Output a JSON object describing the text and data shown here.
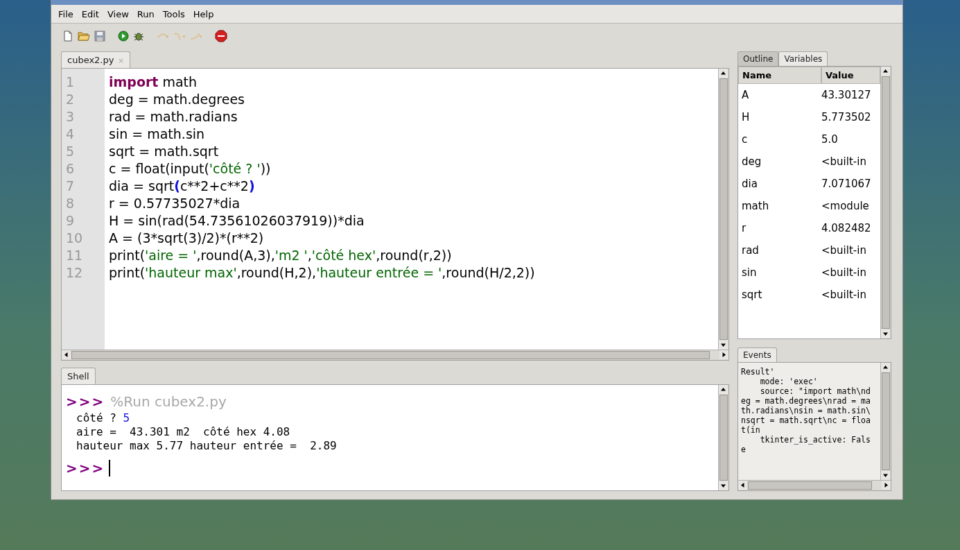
{
  "menu": [
    "File",
    "Edit",
    "View",
    "Run",
    "Tools",
    "Help"
  ],
  "toolbar": [
    {
      "kind": "new",
      "disabled": false
    },
    {
      "kind": "open",
      "disabled": false
    },
    {
      "kind": "save",
      "disabled": true
    },
    {
      "kind": "run",
      "disabled": false
    },
    {
      "kind": "debug",
      "disabled": false
    },
    {
      "kind": "step_over",
      "disabled": true
    },
    {
      "kind": "step_into",
      "disabled": true
    },
    {
      "kind": "step_out",
      "disabled": true
    },
    {
      "kind": "stop",
      "disabled": false
    }
  ],
  "editor": {
    "tabs": [
      {
        "label": "cubex2.py",
        "close": "×"
      }
    ],
    "lines": [
      {
        "number": "1",
        "tokens": [
          {
            "kind": "keyword",
            "text": "import"
          },
          {
            "kind": "plain",
            "text": " math"
          }
        ]
      },
      {
        "number": "2",
        "tokens": [
          {
            "kind": "plain",
            "text": "deg = math.degrees"
          }
        ]
      },
      {
        "number": "3",
        "tokens": [
          {
            "kind": "plain",
            "text": "rad = math.radians"
          }
        ]
      },
      {
        "number": "4",
        "tokens": [
          {
            "kind": "plain",
            "text": "sin = math.sin"
          }
        ]
      },
      {
        "number": "5",
        "tokens": [
          {
            "kind": "plain",
            "text": "sqrt = math.sqrt"
          }
        ]
      },
      {
        "number": "6",
        "tokens": [
          {
            "kind": "plain",
            "text": "c = float(input("
          },
          {
            "kind": "string",
            "text": "'côté ? '"
          },
          {
            "kind": "plain",
            "text": "))"
          }
        ]
      },
      {
        "number": "7",
        "tokens": [
          {
            "kind": "plain",
            "text": "dia = sqrt"
          },
          {
            "kind": "bracket",
            "text": "("
          },
          {
            "kind": "plain",
            "text": "c**2+c**2"
          },
          {
            "kind": "bracket",
            "text": ")"
          }
        ]
      },
      {
        "number": "8",
        "tokens": [
          {
            "kind": "plain",
            "text": "r = 0.57735027*dia"
          }
        ]
      },
      {
        "number": "9",
        "tokens": [
          {
            "kind": "plain",
            "text": "H = sin(rad(54.73561026037919))*dia"
          }
        ]
      },
      {
        "number": "10",
        "tokens": [
          {
            "kind": "plain",
            "text": "A = (3*sqrt(3)/2)*(r**2)"
          }
        ]
      },
      {
        "number": "11",
        "tokens": [
          {
            "kind": "plain",
            "text": "print("
          },
          {
            "kind": "string",
            "text": "'aire = '"
          },
          {
            "kind": "plain",
            "text": ",round(A,3),"
          },
          {
            "kind": "string",
            "text": "'m2 '"
          },
          {
            "kind": "plain",
            "text": ","
          },
          {
            "kind": "string",
            "text": "'côté hex'"
          },
          {
            "kind": "plain",
            "text": ",round(r,2))"
          }
        ]
      },
      {
        "number": "12",
        "tokens": [
          {
            "kind": "plain",
            "text": "print("
          },
          {
            "kind": "string",
            "text": "'hauteur max'"
          },
          {
            "kind": "plain",
            "text": ",round(H,2),"
          },
          {
            "kind": "string",
            "text": "'hauteur entrée = '"
          },
          {
            "kind": "plain",
            "text": ",round(H/2,2))"
          }
        ]
      }
    ]
  },
  "shell": {
    "tab": {
      "label": "Shell"
    },
    "lines": [
      {
        "kind": "command",
        "prompt": ">>>",
        "text": "%Run cubex2.py"
      },
      {
        "kind": "output",
        "tokens": [
          {
            "kind": "plain",
            "text": "côté ? "
          },
          {
            "kind": "input",
            "text": "5"
          }
        ]
      },
      {
        "kind": "output",
        "tokens": [
          {
            "kind": "plain",
            "text": "aire =  43.301 m2  côté hex 4.08"
          }
        ]
      },
      {
        "kind": "output",
        "tokens": [
          {
            "kind": "plain",
            "text": "hauteur max 5.77 hauteur entrée =  2.89"
          }
        ]
      },
      {
        "kind": "prompt",
        "prompt": ">>>"
      }
    ]
  },
  "side_tabs": [
    {
      "label": "Outline",
      "selected": false
    },
    {
      "label": "Variables",
      "selected": true
    }
  ],
  "variables": {
    "columns": [
      "Name",
      "Value"
    ],
    "rows": [
      {
        "name": "A",
        "value": "43.30127"
      },
      {
        "name": "H",
        "value": "5.773502"
      },
      {
        "name": "c",
        "value": "5.0"
      },
      {
        "name": "deg",
        "value": "<built-in"
      },
      {
        "name": "dia",
        "value": "7.071067"
      },
      {
        "name": "math",
        "value": "<module"
      },
      {
        "name": "r",
        "value": "4.082482"
      },
      {
        "name": "rad",
        "value": "<built-in"
      },
      {
        "name": "sin",
        "value": "<built-in"
      },
      {
        "name": "sqrt",
        "value": "<built-in"
      }
    ]
  },
  "events": {
    "tab": {
      "label": "Events"
    },
    "lines": [
      "Result'",
      "    mode: 'exec'",
      "    source: \"import math\\nd",
      "eg = math.degrees\\nrad = ma",
      "th.radians\\nsin = math.sin\\",
      "nsqrt = math.sqrt\\nc = floa",
      "t(in",
      "    tkinter_is_active: Fals",
      "e"
    ]
  }
}
